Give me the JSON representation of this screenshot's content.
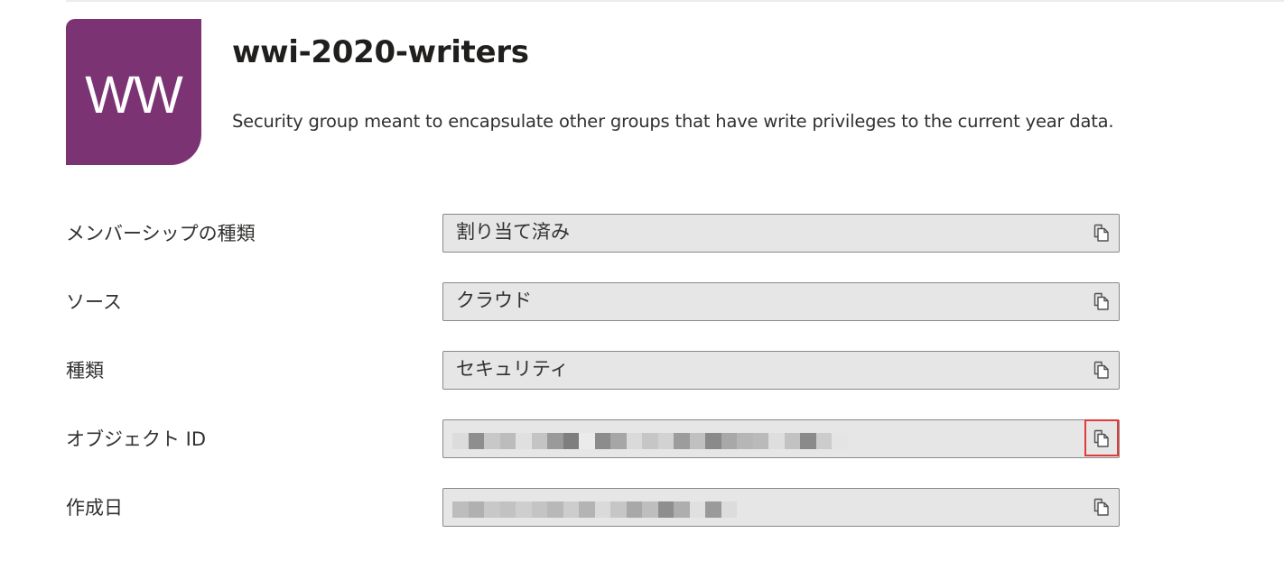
{
  "group": {
    "initials": "WW",
    "avatar_color": "#7b3374",
    "name": "wwi-2020-writers",
    "description": "Security group meant to encapsulate other groups that have write privileges to the current year data."
  },
  "properties": [
    {
      "label": "メンバーシップの種類",
      "value": "割り当て済み",
      "copy_icon": "copy-icon",
      "redacted": false
    },
    {
      "label": "ソース",
      "value": "クラウド",
      "copy_icon": "copy-icon",
      "redacted": false
    },
    {
      "label": "種類",
      "value": "セキュリティ",
      "copy_icon": "copy-icon",
      "redacted": false
    },
    {
      "label": "オブジェクト ID",
      "value": "",
      "copy_icon": "copy-icon",
      "redacted": true,
      "highlighted": true
    },
    {
      "label": "作成日",
      "value": "",
      "copy_icon": "copy-icon",
      "redacted": true
    }
  ],
  "colors": {
    "highlight": "#e03a3a",
    "field_bg": "#e6e6e6",
    "field_border": "#8a8886"
  }
}
